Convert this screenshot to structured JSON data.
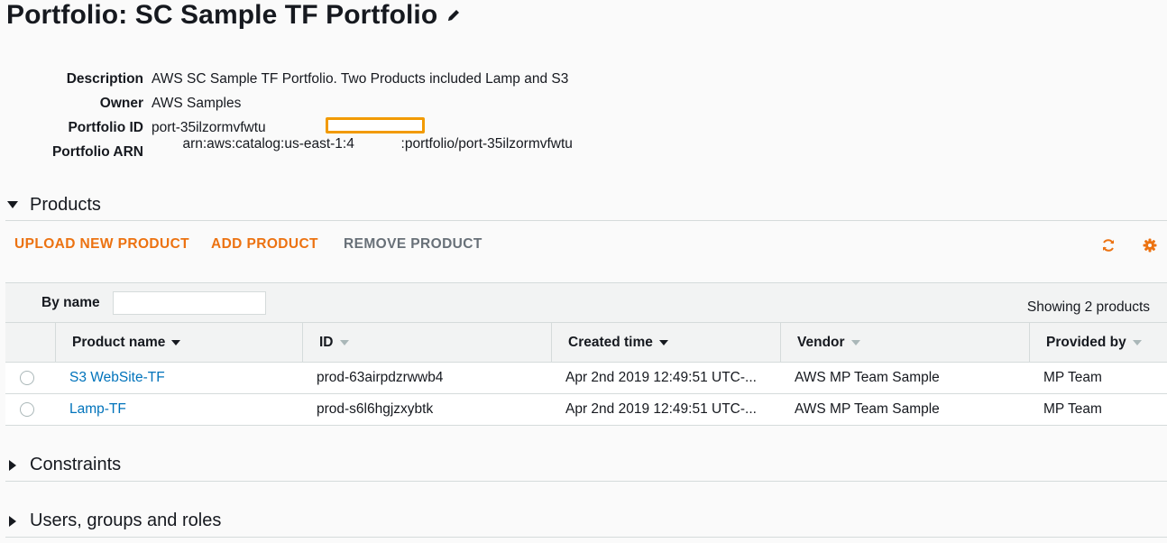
{
  "title": "Portfolio: SC Sample TF Portfolio",
  "details": [
    {
      "label": "Description",
      "value": "AWS SC Sample TF Portfolio. Two Products included Lamp and S3"
    },
    {
      "label": "Owner",
      "value": "AWS Samples"
    },
    {
      "label": "Portfolio ID",
      "value": "port-35ilzormvfwtu"
    },
    {
      "label": "Portfolio ARN",
      "value": "arn:aws:catalog:us-east-1:4            :portfolio/port-35ilzormvfwtu"
    }
  ],
  "sections": {
    "products": "Products",
    "constraints": "Constraints",
    "users": "Users, groups and roles"
  },
  "toolbar": {
    "upload": "UPLOAD NEW PRODUCT",
    "add": "ADD PRODUCT",
    "remove": "REMOVE PRODUCT",
    "refresh_icon": "refresh-icon",
    "settings_icon": "gear-icon"
  },
  "filter": {
    "label": "By name",
    "value": "",
    "placeholder": "",
    "showing": "Showing 2 products"
  },
  "table": {
    "columns": [
      "Product name",
      "ID",
      "Created time",
      "Vendor",
      "Provided by"
    ],
    "rows": [
      {
        "name": "S3 WebSite-TF",
        "id": "prod-63airpdzrwwb4",
        "created": "Apr 2nd 2019 12:49:51 UTC-...",
        "vendor": "AWS MP Team Sample",
        "provided": "MP Team"
      },
      {
        "name": "Lamp-TF",
        "id": "prod-s6l6hgjzxybtk",
        "created": "Apr 2nd 2019 12:49:51 UTC-...",
        "vendor": "AWS MP Team Sample",
        "provided": "MP Team"
      }
    ]
  },
  "colors": {
    "accent_orange": "#ec7211",
    "link_blue": "#0073bb",
    "disabled_gray": "#687078",
    "redaction_orange": "#f29a00"
  }
}
